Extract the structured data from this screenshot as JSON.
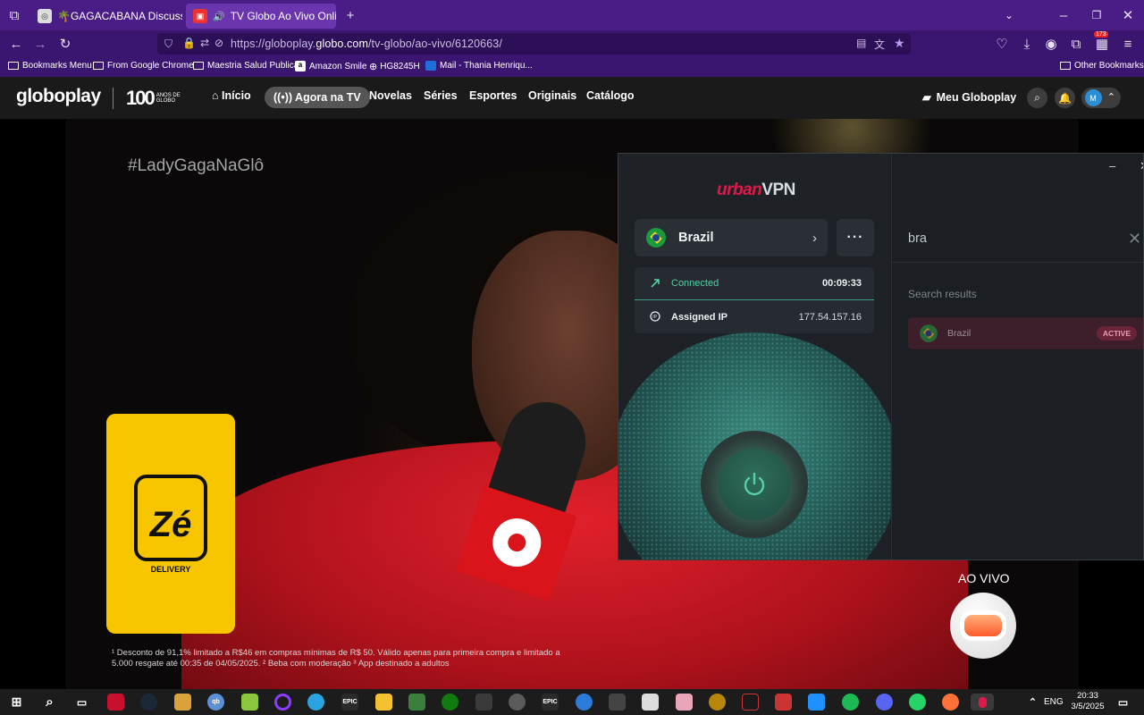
{
  "browser": {
    "tabs": [
      {
        "label": "🌴GAGACABANA Discussion Th",
        "active": false
      },
      {
        "label": "TV Globo Ao Vivo Online G",
        "active": true
      }
    ],
    "url_prefix": "https://globoplay.",
    "url_domain": "globo.com",
    "url_path": "/tv-globo/ao-vivo/6120663/",
    "extension_badge": "173",
    "bookmarks": [
      "Bookmarks Menu",
      "From Google Chrome",
      "Maestria Salud Publica",
      "Amazon Smile",
      "HG8245H",
      "Mail - Thania Henriqu..."
    ],
    "other_bookmarks": "Other Bookmarks"
  },
  "globoplay": {
    "logo": "globoplay",
    "anniversary_number": "100",
    "anniversary_text": "ANOS DE GLOBO",
    "nav": {
      "inicio": "Início",
      "agora": "Agora na TV",
      "novelas": "Novelas",
      "series": "Séries",
      "esportes": "Esportes",
      "originais": "Originais",
      "catalogo": "Catálogo"
    },
    "meu": "Meu Globoplay",
    "avatar_initial": "M"
  },
  "video": {
    "hashtag": "#LadyGagaNaGlô",
    "promo_brand": "Zé",
    "promo_sub": "DELIVERY",
    "disclaimer": "¹ Desconto de 91,1% limitado a R$46 em compras mínimas de R$ 50. Válido apenas para primeira compra e limitado a 5.000 resgate até 00:35 de 04/05/2025. ² Beba com moderação ³ App destinado a adultos",
    "live_label": "AO VIVO"
  },
  "vpn": {
    "brand_part1": "urban",
    "brand_part2": "VPN",
    "country": "Brazil",
    "status_label": "Connected",
    "connected_time": "00:09:33",
    "ip_label": "Assigned IP",
    "ip_value": "177.54.157.16",
    "search_query": "bra",
    "results_label": "Search results",
    "result_country": "Brazil",
    "result_badge": "ACTIVE",
    "accent_color": "#e0184a",
    "connected_color": "#54d1a4"
  },
  "taskbar": {
    "language": "ENG",
    "time": "20:33",
    "date": "3/5/2025"
  }
}
